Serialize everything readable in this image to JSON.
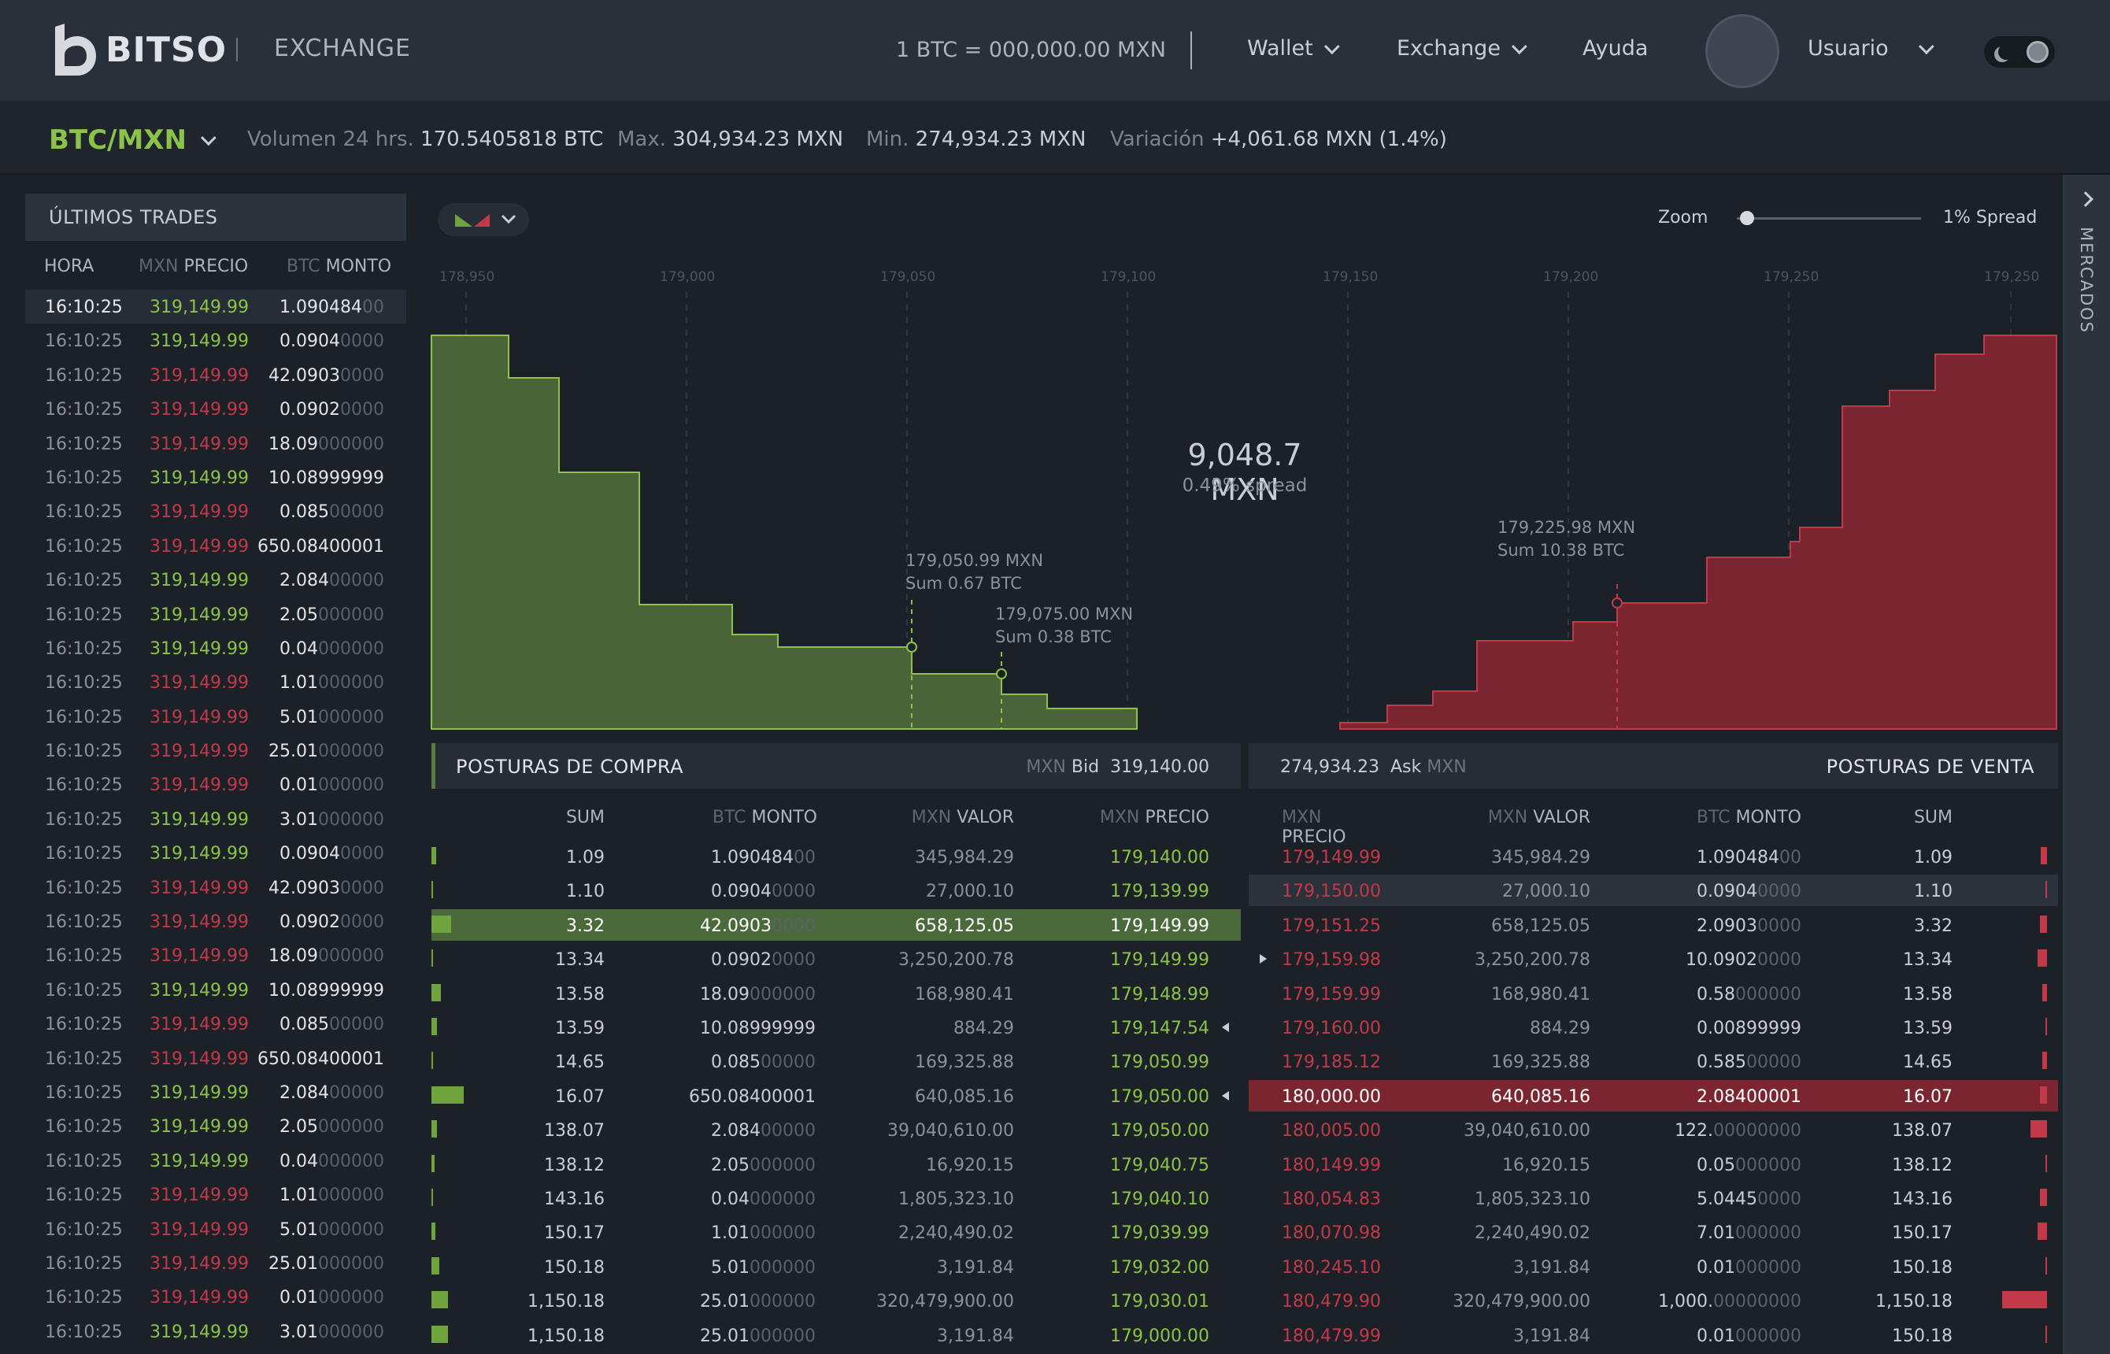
{
  "nav": {
    "logo_text": "BITSO",
    "section": "EXCHANGE",
    "rate": "1 BTC = 000,000.00 MXN",
    "wallet": "Wallet",
    "exchange": "Exchange",
    "help": "Ayuda",
    "user": "Usuario"
  },
  "ticker": {
    "pair": "BTC/MXN",
    "volume_label": "Volumen 24 hrs.",
    "volume_value": "170.5405818 BTC",
    "max_label": "Max.",
    "max_value": "304,934.23 MXN",
    "min_label": "Min.",
    "min_value": "274,934.23 MXN",
    "var_label": "Variación",
    "var_value": "+4,061.68 MXN (1.4%)"
  },
  "trades": {
    "title": "ÚLTIMOS TRADES",
    "col_time": "HORA",
    "col_price_cur": "MXN",
    "col_price": "PRECIO",
    "col_amount_cur": "BTC",
    "col_amount": "MONTO",
    "rows": [
      {
        "time": "16:10:25",
        "price": "319,149.99",
        "side": "g",
        "amt": "1.090484",
        "zeros": "00"
      },
      {
        "time": "16:10:25",
        "price": "319,149.99",
        "side": "g",
        "amt": "0.0904",
        "zeros": "0000"
      },
      {
        "time": "16:10:25",
        "price": "319,149.99",
        "side": "r",
        "amt": "42.0903",
        "zeros": "0000"
      },
      {
        "time": "16:10:25",
        "price": "319,149.99",
        "side": "r",
        "amt": "0.0902",
        "zeros": "0000"
      },
      {
        "time": "16:10:25",
        "price": "319,149.99",
        "side": "r",
        "amt": "18.09",
        "zeros": "000000"
      },
      {
        "time": "16:10:25",
        "price": "319,149.99",
        "side": "g",
        "amt": "10.08999999",
        "zeros": ""
      },
      {
        "time": "16:10:25",
        "price": "319,149.99",
        "side": "r",
        "amt": "0.085",
        "zeros": "00000"
      },
      {
        "time": "16:10:25",
        "price": "319,149.99",
        "side": "r",
        "amt": "650.08400001",
        "zeros": ""
      },
      {
        "time": "16:10:25",
        "price": "319,149.99",
        "side": "g",
        "amt": "2.084",
        "zeros": "00000"
      },
      {
        "time": "16:10:25",
        "price": "319,149.99",
        "side": "g",
        "amt": "2.05",
        "zeros": "000000"
      },
      {
        "time": "16:10:25",
        "price": "319,149.99",
        "side": "g",
        "amt": "0.04",
        "zeros": "000000"
      },
      {
        "time": "16:10:25",
        "price": "319,149.99",
        "side": "r",
        "amt": "1.01",
        "zeros": "000000"
      },
      {
        "time": "16:10:25",
        "price": "319,149.99",
        "side": "r",
        "amt": "5.01",
        "zeros": "000000"
      },
      {
        "time": "16:10:25",
        "price": "319,149.99",
        "side": "r",
        "amt": "25.01",
        "zeros": "000000"
      },
      {
        "time": "16:10:25",
        "price": "319,149.99",
        "side": "r",
        "amt": "0.01",
        "zeros": "000000"
      },
      {
        "time": "16:10:25",
        "price": "319,149.99",
        "side": "g",
        "amt": "3.01",
        "zeros": "000000"
      },
      {
        "time": "16:10:25",
        "price": "319,149.99",
        "side": "g",
        "amt": "0.0904",
        "zeros": "0000"
      },
      {
        "time": "16:10:25",
        "price": "319,149.99",
        "side": "r",
        "amt": "42.0903",
        "zeros": "0000"
      },
      {
        "time": "16:10:25",
        "price": "319,149.99",
        "side": "r",
        "amt": "0.0902",
        "zeros": "0000"
      },
      {
        "time": "16:10:25",
        "price": "319,149.99",
        "side": "r",
        "amt": "18.09",
        "zeros": "000000"
      },
      {
        "time": "16:10:25",
        "price": "319,149.99",
        "side": "g",
        "amt": "10.08999999",
        "zeros": ""
      },
      {
        "time": "16:10:25",
        "price": "319,149.99",
        "side": "r",
        "amt": "0.085",
        "zeros": "00000"
      },
      {
        "time": "16:10:25",
        "price": "319,149.99",
        "side": "r",
        "amt": "650.08400001",
        "zeros": ""
      },
      {
        "time": "16:10:25",
        "price": "319,149.99",
        "side": "g",
        "amt": "2.084",
        "zeros": "00000"
      },
      {
        "time": "16:10:25",
        "price": "319,149.99",
        "side": "g",
        "amt": "2.05",
        "zeros": "000000"
      },
      {
        "time": "16:10:25",
        "price": "319,149.99",
        "side": "g",
        "amt": "0.04",
        "zeros": "000000"
      },
      {
        "time": "16:10:25",
        "price": "319,149.99",
        "side": "r",
        "amt": "1.01",
        "zeros": "000000"
      },
      {
        "time": "16:10:25",
        "price": "319,149.99",
        "side": "r",
        "amt": "5.01",
        "zeros": "000000"
      },
      {
        "time": "16:10:25",
        "price": "319,149.99",
        "side": "r",
        "amt": "25.01",
        "zeros": "000000"
      },
      {
        "time": "16:10:25",
        "price": "319,149.99",
        "side": "r",
        "amt": "0.01",
        "zeros": "000000"
      },
      {
        "time": "16:10:25",
        "price": "319,149.99",
        "side": "g",
        "amt": "3.01",
        "zeros": "000000"
      }
    ]
  },
  "chart": {
    "zoom_label": "Zoom",
    "zoom_value": 0.05,
    "spread_label": "1% Spread",
    "x_ticks": [
      "178,950",
      "179,000",
      "179,050",
      "179,100",
      "179,150",
      "179,200",
      "179,250",
      "179,250"
    ],
    "mid_value": "9,048.7 MXN",
    "mid_spread": "0.49% spread",
    "tip1_price": "179,050.99 MXN",
    "tip1_sum": "Sum 0.67 BTC",
    "tip2_price": "179,075.00 MXN",
    "tip2_sum": "Sum 0.38 BTC",
    "tip3_price": "179,225.98 MXN",
    "tip3_sum": "Sum 10.38 BTC",
    "colors": {
      "bid": "#4a6339",
      "ask": "#7b2530"
    }
  },
  "markets_label": "MERCADOS",
  "buy": {
    "title": "POSTURAS DE COMPRA",
    "bid_cur": "MXN",
    "bid_label": "Bid",
    "bid_value": "319,140.00",
    "col_sum": "SUM",
    "col_amount_cur": "BTC",
    "col_amount": "MONTO",
    "col_value_cur": "MXN",
    "col_value": "VALOR",
    "col_price_cur": "MXN",
    "col_price": "PRECIO",
    "rows": [
      {
        "sum": "1.09",
        "amt": "1.090484",
        "z": "00",
        "val": "345,984.29",
        "price": "179,140.00",
        "bar": 0.006
      },
      {
        "sum": "1.10",
        "amt": "0.0904",
        "z": "0000",
        "val": "27,000.10",
        "price": "179,139.99",
        "bar": 0.002
      },
      {
        "sum": "3.32",
        "amt": "42.0903",
        "z": "0000",
        "val": "658,125.05",
        "price": "179,149.99",
        "bar": 0.024
      },
      {
        "sum": "13.34",
        "amt": "0.0902",
        "z": "0000",
        "val": "3,250,200.78",
        "price": "179,149.99",
        "bar": 0.002
      },
      {
        "sum": "13.58",
        "amt": "18.09",
        "z": "000000",
        "val": "168,980.41",
        "price": "179,148.99",
        "bar": 0.012
      },
      {
        "sum": "13.59",
        "amt": "10.08999999",
        "z": "",
        "val": "884.29",
        "price": "179,147.54",
        "bar": 0.007
      },
      {
        "sum": "14.65",
        "amt": "0.085",
        "z": "00000",
        "val": "169,325.88",
        "price": "179,050.99",
        "bar": 0.002
      },
      {
        "sum": "16.07",
        "amt": "650.08400001",
        "z": "",
        "val": "640,085.16",
        "price": "179,050.00",
        "bar": 0.04
      },
      {
        "sum": "138.07",
        "amt": "2.084",
        "z": "00000",
        "val": "39,040,610.00",
        "price": "179,050.00",
        "bar": 0.007
      },
      {
        "sum": "138.12",
        "amt": "2.05",
        "z": "000000",
        "val": "16,920.15",
        "price": "179,040.75",
        "bar": 0.004
      },
      {
        "sum": "143.16",
        "amt": "0.04",
        "z": "000000",
        "val": "1,805,323.10",
        "price": "179,040.10",
        "bar": 0.0005
      },
      {
        "sum": "150.17",
        "amt": "1.01",
        "z": "000000",
        "val": "2,240,490.02",
        "price": "179,039.99",
        "bar": 0.005
      },
      {
        "sum": "150.18",
        "amt": "5.01",
        "z": "000000",
        "val": "3,191.84",
        "price": "179,032.00",
        "bar": 0.01
      },
      {
        "sum": "1,150.18",
        "amt": "25.01",
        "z": "000000",
        "val": "320,479,900.00",
        "price": "179,030.01",
        "bar": 0.02
      },
      {
        "sum": "1,150.18",
        "amt": "25.01",
        "z": "000000",
        "val": "3,191.84",
        "price": "179,000.00",
        "bar": 0.02
      }
    ]
  },
  "sell": {
    "title": "POSTURAS DE VENTA",
    "ask_value": "274,934.23",
    "ask_label": "Ask",
    "ask_cur": "MXN",
    "col_price_cur": "MXN",
    "col_price": "PRECIO",
    "col_value_cur": "MXN",
    "col_value": "VALOR",
    "col_amount_cur": "BTC",
    "col_amount": "MONTO",
    "col_sum": "SUM",
    "rows": [
      {
        "price": "179,149.99",
        "val": "345,984.29",
        "amt": "1.090484",
        "z": "00",
        "sum": "1.09",
        "bar": 0.008
      },
      {
        "price": "179,150.00",
        "val": "27,000.10",
        "amt": "0.0904",
        "z": "0000",
        "sum": "1.10",
        "bar": 0.002
      },
      {
        "price": "179,151.25",
        "val": "658,125.05",
        "amt": "2.0903",
        "z": "0000",
        "sum": "3.32",
        "bar": 0.009
      },
      {
        "price": "179,159.98",
        "val": "3,250,200.78",
        "amt": "10.0902",
        "z": "0000",
        "sum": "13.34",
        "bar": 0.012
      },
      {
        "price": "179,159.99",
        "val": "168,980.41",
        "amt": "0.58",
        "z": "000000",
        "sum": "13.58",
        "bar": 0.006
      },
      {
        "price": "179,160.00",
        "val": "884.29",
        "amt": "0.00899999",
        "z": "",
        "sum": "13.59",
        "bar": 0.0
      },
      {
        "price": "179,185.12",
        "val": "169,325.88",
        "amt": "0.585",
        "z": "00000",
        "sum": "14.65",
        "bar": 0.006
      },
      {
        "price": "180,000.00",
        "val": "640,085.16",
        "amt": "2.08400001",
        "z": "",
        "sum": "16.07",
        "bar": 0.009
      },
      {
        "price": "180,005.00",
        "val": "39,040,610.00",
        "amt": "122.",
        "z": "00000000",
        "sum": "138.07",
        "bar": 0.02
      },
      {
        "price": "180,149.99",
        "val": "16,920.15",
        "amt": "0.05",
        "z": "000000",
        "sum": "138.12",
        "bar": 0.002
      },
      {
        "price": "180,054.83",
        "val": "1,805,323.10",
        "amt": "5.0445",
        "z": "0000",
        "sum": "143.16",
        "bar": 0.009
      },
      {
        "price": "180,070.98",
        "val": "2,240,490.02",
        "amt": "7.01",
        "z": "000000",
        "sum": "150.17",
        "bar": 0.012
      },
      {
        "price": "180,245.10",
        "val": "3,191.84",
        "amt": "0.01",
        "z": "000000",
        "sum": "150.18",
        "bar": 0.002
      },
      {
        "price": "180,479.90",
        "val": "320,479,900.00",
        "amt": "1,000.",
        "z": "00000000",
        "sum": "1,150.18",
        "bar": 0.055
      },
      {
        "price": "180,479.99",
        "val": "3,191.84",
        "amt": "0.01",
        "z": "000000",
        "sum": "150.18",
        "bar": 0.002
      }
    ]
  }
}
